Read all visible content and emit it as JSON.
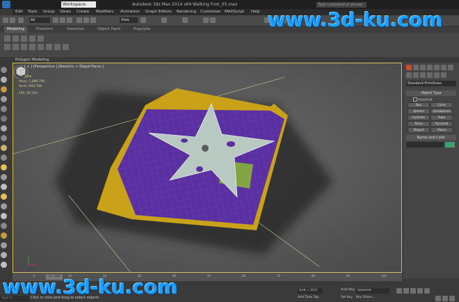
{
  "titlebar": {
    "workspace": "Workspace: Default",
    "title": "Autodesk 3ds Max  2014 x64      Walking Foot_05.max",
    "search_placeholder": "Type a keyword or phrase"
  },
  "menu": [
    "Edit",
    "Tools",
    "Group",
    "Views",
    "Create",
    "Modifiers",
    "Animation",
    "Graph Editors",
    "Rendering",
    "Customize",
    "MAXScript",
    "Help"
  ],
  "toolbar": {
    "selection_filter": "All",
    "reference_coord": "View"
  },
  "ribbon": {
    "tabs": [
      "Modeling",
      "Freeform",
      "Selection",
      "Object Paint",
      "Populate"
    ],
    "active_tab": "Modeling",
    "panel_label": "Polygon Modeling"
  },
  "viewport": {
    "label": "[ + ] [Perspective ] [Realistic + Edged Faces ]",
    "stats": {
      "total_label": "Total",
      "polys_label": "Polys:",
      "polys": "1,889,796",
      "verts_label": "Verts:",
      "verts": "950,708",
      "fps_label": "FPS:",
      "fps": "50.310"
    }
  },
  "command_panel": {
    "dropdown": "Standard Primitives",
    "object_type_title": "Object Type",
    "autogrid": "AutoGrid",
    "objects": [
      "Box",
      "Cone",
      "Sphere",
      "GeoSphere",
      "Cylinder",
      "Tube",
      "Torus",
      "Pyramid",
      "Teapot",
      "Plane"
    ],
    "name_color_title": "Name and Color"
  },
  "timeline": {
    "frame_counter": "0 / 100",
    "ticks": [
      "0",
      "10",
      "20",
      "30",
      "40",
      "50",
      "60",
      "70",
      "80",
      "90",
      "100"
    ]
  },
  "statusbar": {
    "maxscript": "Type in",
    "status_text": "Click or click-and-drag to select objects",
    "grid": "Grid = 10.0",
    "add_time_tag": "Add Time Tag",
    "auto_key": "Auto Key",
    "selected": "Selected",
    "set_key": "Set Key",
    "key_filters": "Key Filters..."
  },
  "watermark": "www.3d-ku.com",
  "colors": {
    "purple_surface": "#5a2fa0",
    "yellow_base": "#c9a21a",
    "shuriken": "#b8c9c2",
    "viewport_border": "#d7c35a"
  }
}
